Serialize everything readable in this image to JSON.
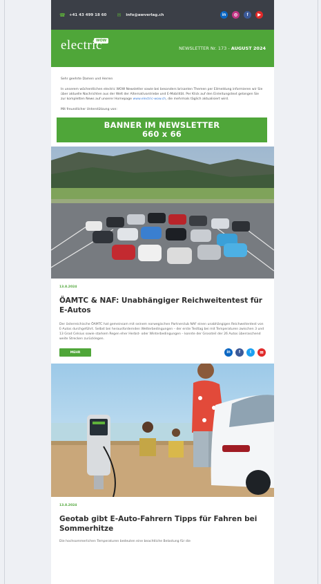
{
  "topbar": {
    "phone": "+41 43 499 18 60",
    "email": "info@awverlag.ch",
    "socials": [
      {
        "icon": "linkedin-icon",
        "label": "in",
        "color": "#0a66c2"
      },
      {
        "icon": "instagram-icon",
        "label": "◎",
        "color": "#c13584"
      },
      {
        "icon": "facebook-icon",
        "label": "f",
        "color": "#3b5998"
      },
      {
        "icon": "youtube-icon",
        "label": "▶",
        "color": "#e02a2a"
      }
    ]
  },
  "header": {
    "logo": "electric",
    "logo_badge": "WOW",
    "issue_prefix": "NEWSLETTER Nr. 173 - ",
    "issue_month": "AUGUST 2024"
  },
  "intro": {
    "greeting": "Sehr geehrte Damen und Herren",
    "text_before_link": "In unserem wöchentlichen electric WOW Newsletter sowie bei besonders brisanten Themen per Eilmeldung informieren wir Sie über aktuelle Nachrichten aus der Welt der Alternativantriebe und E-Mobilität. Per Klick auf den Einleitungstext gelangen Sie zur kompletten News auf unserer Homepage ",
    "link": "www.electric-wow.ch",
    "text_after_link": ", die mehrmals täglich aktualisiert wird.",
    "sponsor": "Mit freundlicher Unterstützung von:"
  },
  "banner": {
    "line1": "BANNER IM NEWSLETTER",
    "line2": "660 x 66"
  },
  "article1": {
    "date": "13.8.2024",
    "title": "ÖAMTC & NAF: Unabhängiger Reichweitentest für E-Autos",
    "body": "Der österreichische ÖAMTC hat gemeinsam mit seinem norwegischen Partnerclub NAF einen unabhängigen Reichweitentest von E-Autos durchgeführt. Selbst bei herausfordernden Wetterbedingungen – der erste Testtag bei mit Temperaturen zwischen 3 und 13 Grad Celsius sowie starkem Regen eher Herbst- oder Winterbedingungen – konnte der Grossteil der 26 Autos überraschend weite Strecken zurücklegen.",
    "more": "MEHR",
    "share": [
      {
        "icon": "linkedin-icon",
        "label": "in",
        "color": "#0a66c2"
      },
      {
        "icon": "facebook-icon",
        "label": "f",
        "color": "#3b5998"
      },
      {
        "icon": "twitter-icon",
        "label": "t",
        "color": "#1da1f2"
      },
      {
        "icon": "mail-icon",
        "label": "✉",
        "color": "#e02a2a"
      }
    ]
  },
  "article2": {
    "date": "13.8.2024",
    "title": "Geotab gibt E-Auto-Fahrern Tipps für Fahren bei Sommerhitze",
    "body": "Die hochsommerlichen Temperaturen bedeuten eine beachtliche Belastung für die"
  }
}
